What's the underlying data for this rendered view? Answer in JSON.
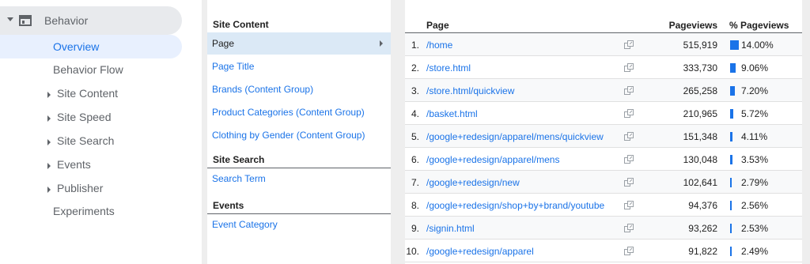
{
  "sidebar": {
    "behavior_label": "Behavior",
    "overview_label": "Overview",
    "items": [
      {
        "label": "Behavior Flow",
        "expandable": false
      },
      {
        "label": "Site Content",
        "expandable": true
      },
      {
        "label": "Site Speed",
        "expandable": true
      },
      {
        "label": "Site Search",
        "expandable": true
      },
      {
        "label": "Events",
        "expandable": true
      },
      {
        "label": "Publisher",
        "expandable": true
      },
      {
        "label": "Experiments",
        "expandable": false
      }
    ]
  },
  "dimensions": {
    "site_content_header": "Site Content",
    "site_content_items": [
      "Page",
      "Page Title",
      "Brands (Content Group)",
      "Product Categories (Content Group)",
      "Clothing by Gender (Content Group)"
    ],
    "site_search_header": "Site Search",
    "site_search_items": [
      "Search Term"
    ],
    "events_header": "Events",
    "events_items": [
      "Event Category"
    ],
    "selected": "Page"
  },
  "table": {
    "col_page": "Page",
    "col_pageviews": "Pageviews",
    "col_pct": "% Pageviews",
    "bar_color": "#1a73e8",
    "rows": [
      {
        "idx": "1.",
        "page": "/home",
        "pageviews": "515,919",
        "pct": "14.00%",
        "pct_value": 14.0
      },
      {
        "idx": "2.",
        "page": "/store.html",
        "pageviews": "333,730",
        "pct": "9.06%",
        "pct_value": 9.06
      },
      {
        "idx": "3.",
        "page": "/store.html/quickview",
        "pageviews": "265,258",
        "pct": "7.20%",
        "pct_value": 7.2
      },
      {
        "idx": "4.",
        "page": "/basket.html",
        "pageviews": "210,965",
        "pct": "5.72%",
        "pct_value": 5.72
      },
      {
        "idx": "5.",
        "page": "/google+redesign/apparel/mens/quickview",
        "pageviews": "151,348",
        "pct": "4.11%",
        "pct_value": 4.11
      },
      {
        "idx": "6.",
        "page": "/google+redesign/apparel/mens",
        "pageviews": "130,048",
        "pct": "3.53%",
        "pct_value": 3.53
      },
      {
        "idx": "7.",
        "page": "/google+redesign/new",
        "pageviews": "102,641",
        "pct": "2.79%",
        "pct_value": 2.79
      },
      {
        "idx": "8.",
        "page": "/google+redesign/shop+by+brand/youtube",
        "pageviews": "94,376",
        "pct": "2.56%",
        "pct_value": 2.56
      },
      {
        "idx": "9.",
        "page": "/signin.html",
        "pageviews": "93,262",
        "pct": "2.53%",
        "pct_value": 2.53
      },
      {
        "idx": "10.",
        "page": "/google+redesign/apparel",
        "pageviews": "91,822",
        "pct": "2.49%",
        "pct_value": 2.49
      }
    ]
  }
}
